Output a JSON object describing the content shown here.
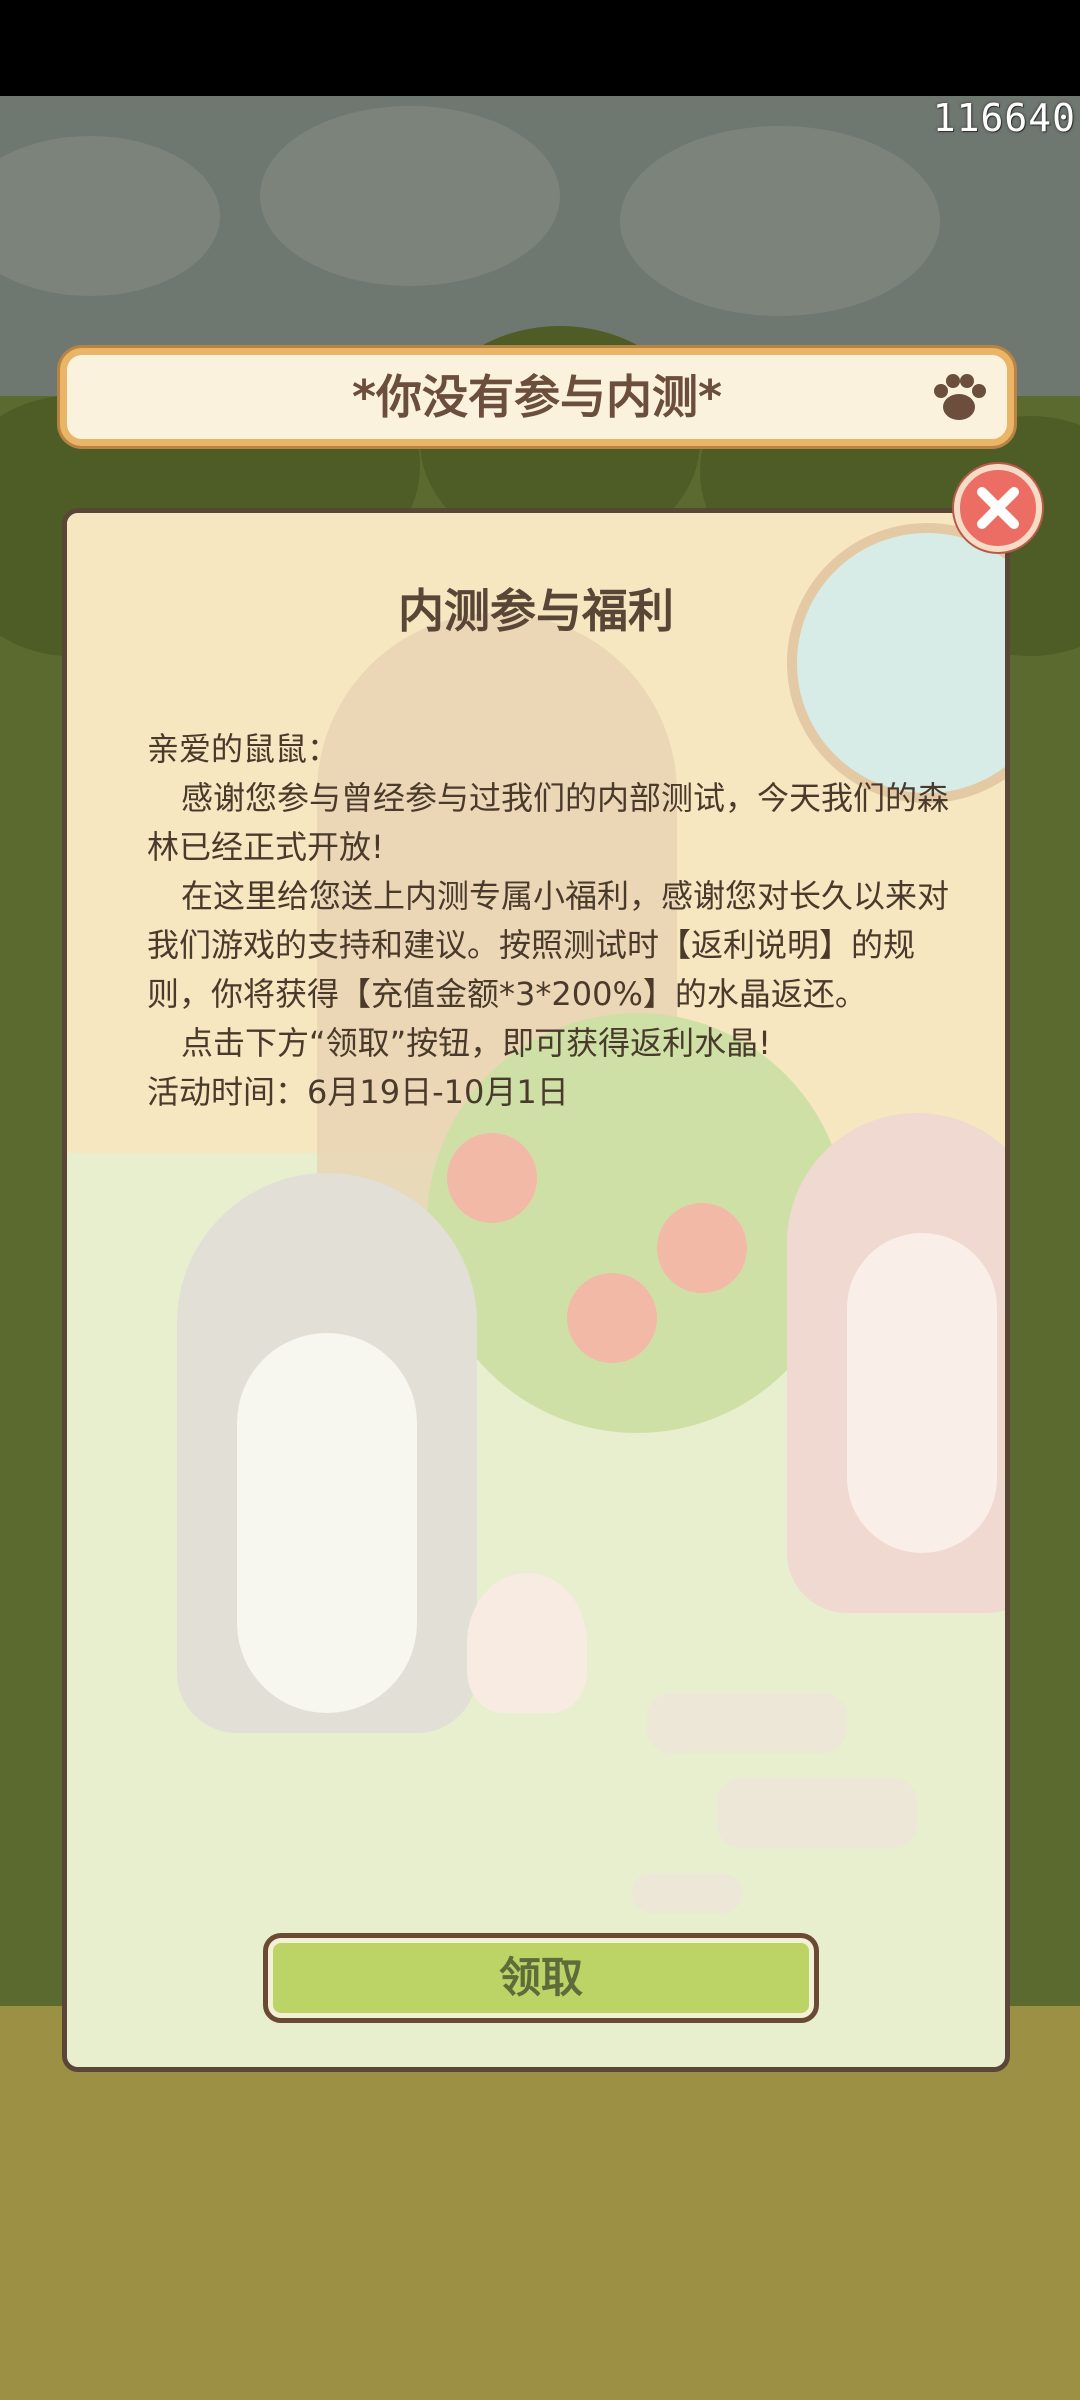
{
  "status": {
    "counter": "116640"
  },
  "banner": {
    "title": "*你没有参与内测*",
    "icon": "paw-icon"
  },
  "dialog": {
    "heading": "内测参与福利",
    "greeting": "亲爱的鼠鼠：",
    "para1": "感谢您参与曾经参与过我们的内部测试，今天我们的森林已经正式开放!",
    "para2": "在这里给您送上内测专属小福利，感谢您对长久以来对我们游戏的支持和建议。按照测试时【返利说明】的规则，你将获得【充值金额*3*200%】的水晶返还。",
    "para3": "点击下方“领取”按钮，即可获得返利水晶!",
    "event_time": "活动时间：6月19日-10月1日",
    "claim_label": "领取",
    "close_icon": "close-icon"
  },
  "colors": {
    "banner_bg": "#fbf2de",
    "banner_border": "#e9b567",
    "button_green": "#bcd365",
    "close_red": "#ec6d63",
    "text_brown": "#5a4636"
  }
}
